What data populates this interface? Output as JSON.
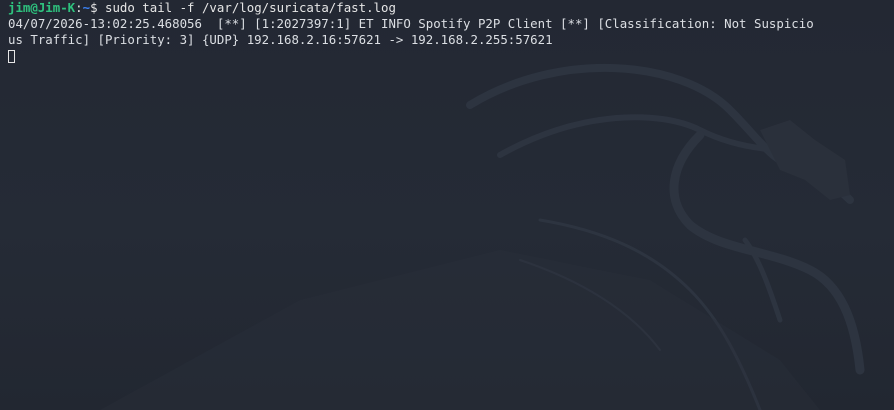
{
  "terminal": {
    "prompt_user_host": "jim@Jim-K",
    "prompt_sep": ":",
    "prompt_path": "~",
    "prompt_symbol": "$ ",
    "command": "sudo tail -f /var/log/suricata/fast.log",
    "output_lines": [
      "04/07/2026-13:02:25.468056  [**] [1:2027397:1] ET INFO Spotify P2P Client [**] [Classification: Not Suspicio",
      "us Traffic] [Priority: 3] {UDP} 192.168.2.16:57621 -> 192.168.2.255:57621"
    ]
  },
  "colors": {
    "background": "#242a35",
    "prompt_user": "#2ec27e",
    "prompt_path": "#3b82f6",
    "text": "#dcdfe4"
  },
  "icons": {
    "wallpaper": "kali-dragon-watermark"
  }
}
